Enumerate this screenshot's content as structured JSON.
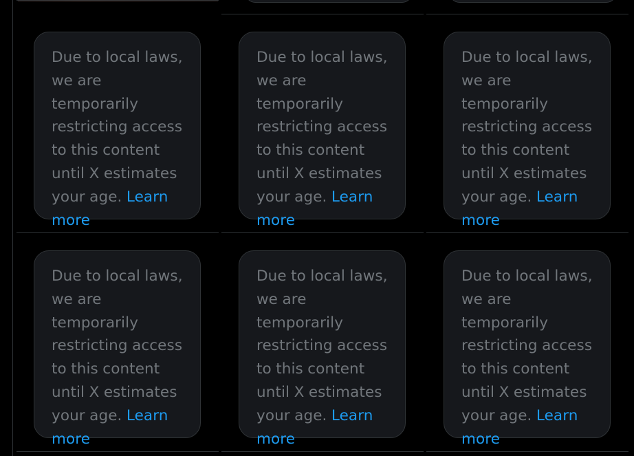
{
  "restriction_notice": {
    "message": "Due to local laws, we are temporarily restricting access to this content until X estimates your age.",
    "link_label": "Learn more"
  },
  "grid": {
    "cells": [
      {
        "id": 1
      },
      {
        "id": 2
      },
      {
        "id": 3
      },
      {
        "id": 4
      },
      {
        "id": 5
      },
      {
        "id": 6
      }
    ]
  },
  "colors": {
    "background": "#000000",
    "card_background": "#16181c",
    "border": "#2f3336",
    "text_secondary": "#71767b",
    "link": "#1d9bf0"
  }
}
